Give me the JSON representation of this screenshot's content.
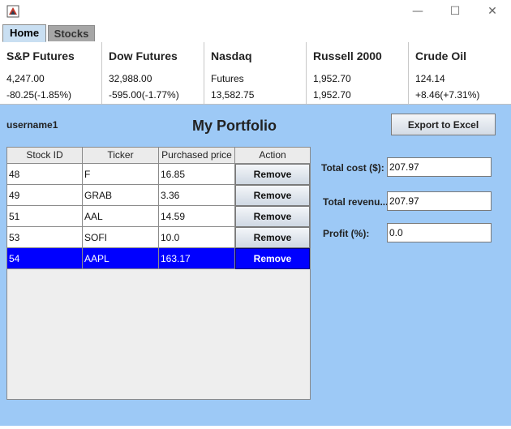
{
  "window": {
    "minimize_glyph": "—",
    "maximize_glyph": "☐",
    "close_glyph": "✕"
  },
  "tabs": [
    {
      "label": "Home",
      "selected": true
    },
    {
      "label": "Stocks",
      "selected": false
    }
  ],
  "ticker": [
    {
      "name": "S&P Futures",
      "line1": "4,247.00",
      "line2": "-80.25(-1.85%)"
    },
    {
      "name": "Dow Futures",
      "line1": "32,988.00",
      "line2": "-595.00(-1.77%)"
    },
    {
      "name": "Nasdaq",
      "line1": "Futures",
      "line2": "13,582.75"
    },
    {
      "name": "Russell 2000",
      "line1": "1,952.70",
      "line2": "1,952.70"
    },
    {
      "name": "Crude Oil",
      "line1": "124.14",
      "line2": "+8.46(+7.31%)"
    }
  ],
  "portfolio": {
    "username": "username1",
    "title": "My Portfolio",
    "export_label": "Export to Excel"
  },
  "table": {
    "columns": [
      "Stock ID",
      "Ticker",
      "Purchased price",
      "Action"
    ],
    "rows": [
      {
        "id": "48",
        "ticker": "F",
        "price": "16.85",
        "action": "Remove",
        "selected": false
      },
      {
        "id": "49",
        "ticker": "GRAB",
        "price": "3.36",
        "action": "Remove",
        "selected": false
      },
      {
        "id": "51",
        "ticker": "AAL",
        "price": "14.59",
        "action": "Remove",
        "selected": false
      },
      {
        "id": "53",
        "ticker": "SOFI",
        "price": "10.0",
        "action": "Remove",
        "selected": false
      },
      {
        "id": "54",
        "ticker": "AAPL",
        "price": "163.17",
        "action": "Remove",
        "selected": true
      }
    ]
  },
  "summary": {
    "total_cost_label": "Total cost ($):",
    "total_cost_value": "207.97",
    "total_revenue_label": "Total revenu...",
    "total_revenue_value": "207.97",
    "profit_label": "Profit (%):",
    "profit_value": "0.0"
  },
  "colors": {
    "main_background": "#9dc9f6",
    "selection": "#0000ff",
    "home_tab": "#c9dff2",
    "inactive_tab": "#a6a6a6"
  },
  "icons": {
    "app": "java-app-icon"
  }
}
